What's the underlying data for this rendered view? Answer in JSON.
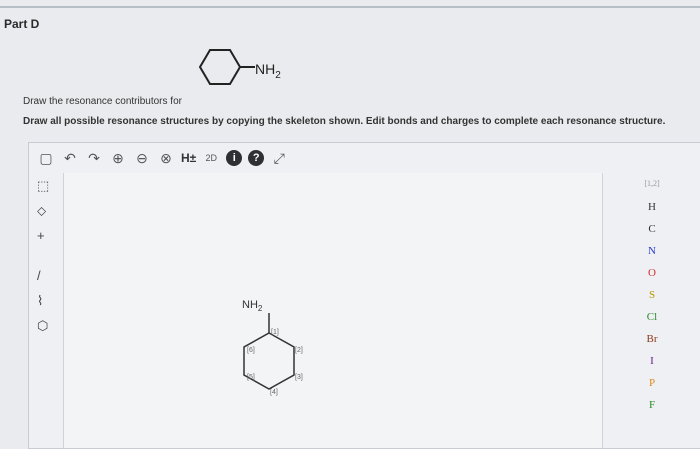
{
  "part": {
    "title": "Part D"
  },
  "question": {
    "molecule_substituent": "NH",
    "molecule_sub": "2",
    "instruction_1": "Draw the resonance contributors for",
    "instruction_2": "Draw all possible resonance structures by copying the skeleton shown. Edit bonds and charges to complete each resonance structure."
  },
  "toolbar": {
    "h_label": "H±",
    "info_label": "i",
    "help_label": "?",
    "stereo_label": "2D"
  },
  "canvas_molecule": {
    "label": "NH",
    "sub": "2",
    "indices": [
      "[1]",
      "[2]",
      "[3]",
      "[4]",
      "[5]",
      "[6]"
    ]
  },
  "periodic": {
    "top_label": "[1,2]",
    "elements": [
      "H",
      "C",
      "N",
      "O",
      "S",
      "Cl",
      "Br",
      "I",
      "P",
      "F"
    ],
    "colors": {
      "N": "#2a3bd1",
      "O": "#d22b2b",
      "S": "#b59a00",
      "Cl": "#2b8a2b",
      "Br": "#8a3b1b",
      "P": "#d98a1b",
      "F": "#2b8a2b"
    }
  }
}
